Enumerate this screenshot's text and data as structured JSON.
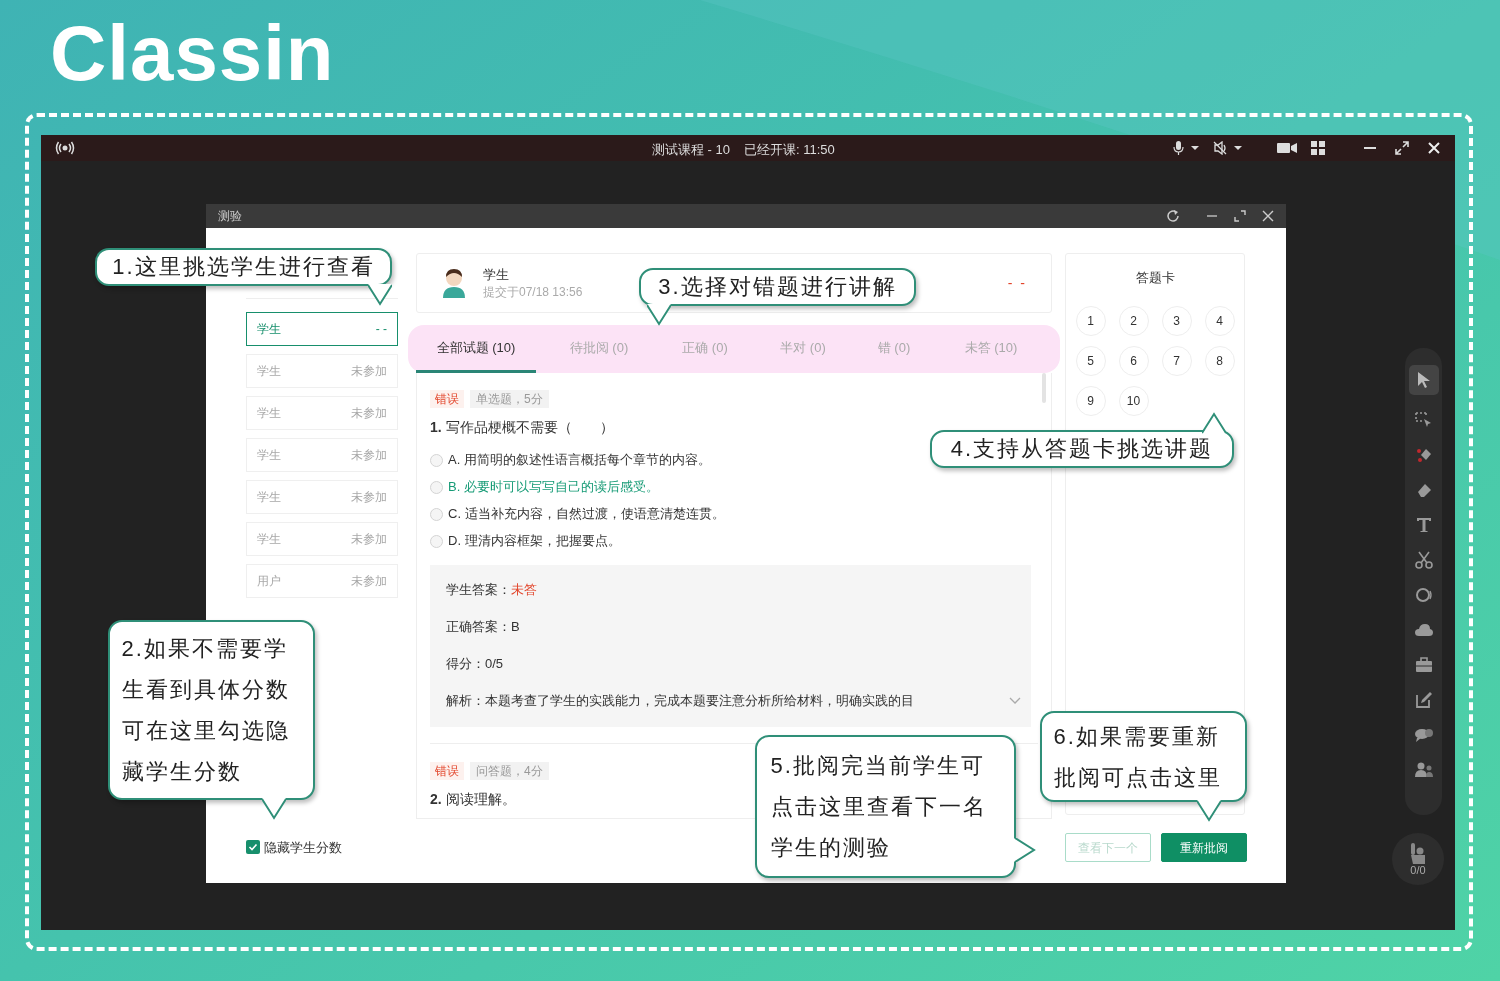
{
  "brand": {
    "logo": "Classin"
  },
  "app": {
    "course": "测试课程 - 10",
    "elapsed": "已经开课: 11:50",
    "hand_count": "0/0"
  },
  "dialog": {
    "title": "测验"
  },
  "students": [
    {
      "name": "学生",
      "status": "- -",
      "selected": true
    },
    {
      "name": "学生",
      "status": "未参加",
      "selected": false
    },
    {
      "name": "学生",
      "status": "未参加",
      "selected": false
    },
    {
      "name": "学生",
      "status": "未参加",
      "selected": false
    },
    {
      "name": "学生",
      "status": "未参加",
      "selected": false
    },
    {
      "name": "学生",
      "status": "未参加",
      "selected": false
    },
    {
      "name": "用户",
      "status": "未参加",
      "selected": false
    }
  ],
  "hide_scores": {
    "label": "隐藏学生分数",
    "checked": true
  },
  "student": {
    "name": "学生",
    "submitted": "提交于07/18 13:56",
    "score": "- -"
  },
  "tabs": [
    {
      "label": "全部试题 (10)",
      "selected": true
    },
    {
      "label": "待批阅 (0)",
      "selected": false
    },
    {
      "label": "正确 (0)",
      "selected": false
    },
    {
      "label": "半对 (0)",
      "selected": false
    },
    {
      "label": "错 (0)",
      "selected": false
    },
    {
      "label": "未答 (10)",
      "selected": false
    }
  ],
  "questions": [
    {
      "result": "错误",
      "meta": "单选题，5分",
      "title": "**1.** 写作品梗概不需要（　　）",
      "options": [
        {
          "text": "A. 用简明的叙述性语言概括每个章节的内容。",
          "correct": false,
          "checked": false
        },
        {
          "text": "B. 必要时可以写写自己的读后感受。",
          "correct": true,
          "checked": false
        },
        {
          "text": "C. 适当补充内容，自然过渡，使语意清楚连贯。",
          "correct": false,
          "checked": false
        },
        {
          "text": "D. 理清内容框架，把握要点。",
          "correct": false,
          "checked": false
        }
      ],
      "student_answer": {
        "label": "学生答案：",
        "value": "未答"
      },
      "correct_answer": "正确答案：B",
      "score": "得分：0/5",
      "analysis": "解析：本题考查了学生的实践能力，完成本题要注意分析所给材料，明确实践的目"
    },
    {
      "result": "错误",
      "meta": "问答题，4分",
      "title": "**2.** 阅读理解。"
    }
  ],
  "answer_card": {
    "title": "答题卡",
    "items": [
      "1",
      "2",
      "3",
      "4",
      "5",
      "6",
      "7",
      "8",
      "9",
      "10"
    ]
  },
  "buttons": [
    {
      "label": "查看下一个",
      "kind": "outline",
      "disabled": true
    },
    {
      "label": "重新批阅",
      "kind": "primary",
      "disabled": false
    }
  ],
  "callouts": [
    {
      "text": "1.这里挑选学生进行查看"
    },
    {
      "text": "3.选择对错题进行讲解"
    },
    {
      "text": "4.支持从答题卡挑选讲题"
    },
    {
      "text": "2.如果不需要学生看到具体分数可在这里勾选隐藏学生分数"
    },
    {
      "text": "5.批阅完当前学生可点击这里查看下一名学生的测验"
    },
    {
      "text": "6.如果需要重新批阅可点击这里"
    }
  ]
}
